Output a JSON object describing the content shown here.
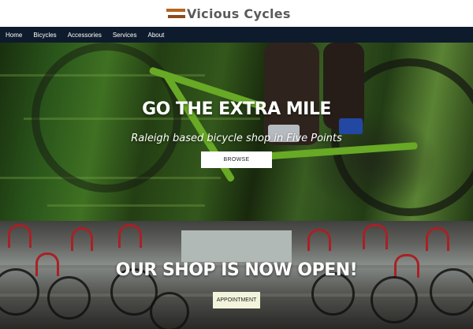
{
  "brand": {
    "name": "Vicious Cycles",
    "accent": "#b8641f",
    "text_color": "#5a5a5a"
  },
  "nav": {
    "background": "#0e1b2c",
    "items": [
      "Home",
      "Bicycles",
      "Accessories",
      "Services",
      "About"
    ]
  },
  "hero": {
    "title": "GO THE EXTRA MILE",
    "subtitle": "Raleigh based bicycle shop in Five Points",
    "button_label": "BROWSE"
  },
  "shop": {
    "title": "OUR SHOP IS NOW OPEN!",
    "button_label": "APPOINTMENT"
  }
}
